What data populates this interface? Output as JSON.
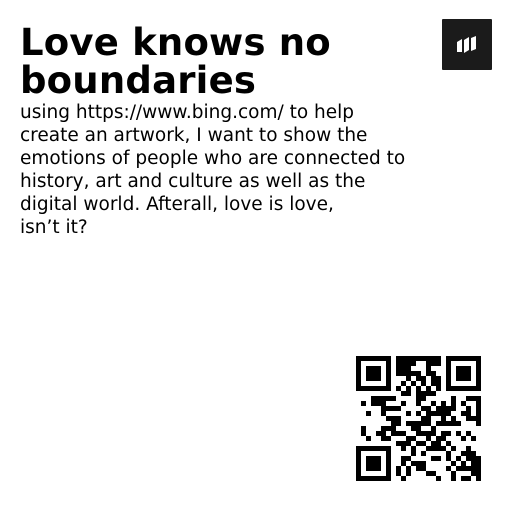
{
  "page": {
    "title": "Love knows no boundaries",
    "description": "using https://www.bing.com/ to help\ncreate an artwork, I want to show the\nemotions of people who are connected to\nhistory, art and culture as well as the\ndigital world. Afterall, love is love,\nisn’t it?"
  },
  "logo": {
    "icon": "brand-mark-icon",
    "color": "#1b1b1b"
  },
  "qr_code": {
    "icon": "qr-code-icon",
    "color": "#000000"
  }
}
